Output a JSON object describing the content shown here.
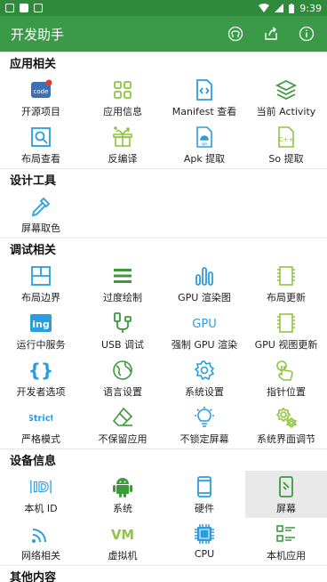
{
  "status_bar": {
    "time": "9:39"
  },
  "app_bar": {
    "title": "开发助手"
  },
  "colors": {
    "accent_green": "#3a9a48",
    "icon_blue": "#2a9de0",
    "icon_lime": "#8dc63f",
    "icon_dark_green": "#3c9a3c"
  },
  "sections": [
    {
      "title": "应用相关",
      "items": [
        {
          "label": "开源项目",
          "icon": "code-badge-icon"
        },
        {
          "label": "应用信息",
          "icon": "apps-grid-icon"
        },
        {
          "label": "Manifest 查看",
          "icon": "code-file-icon"
        },
        {
          "label": "当前 Activity",
          "icon": "layers-icon"
        },
        {
          "label": "布局查看",
          "icon": "layout-search-icon"
        },
        {
          "label": "反编译",
          "icon": "gift-box-icon"
        },
        {
          "label": "Apk 提取",
          "icon": "apk-file-icon"
        },
        {
          "label": "So 提取",
          "icon": "cpp-file-icon"
        }
      ]
    },
    {
      "title": "设计工具",
      "items": [
        {
          "label": "屏幕取色",
          "icon": "eyedropper-icon"
        }
      ]
    },
    {
      "title": "调试相关",
      "items": [
        {
          "label": "布局边界",
          "icon": "layout-bounds-icon"
        },
        {
          "label": "过度绘制",
          "icon": "overdraw-icon"
        },
        {
          "label": "GPU 渲染图",
          "icon": "bar-chart-icon"
        },
        {
          "label": "布局更新",
          "icon": "layout-update-icon"
        },
        {
          "label": "运行中服务",
          "icon": "ing-badge-icon"
        },
        {
          "label": "USB 调试",
          "icon": "usb-icon"
        },
        {
          "label": "强制 GPU 渲染",
          "icon": "gpu-text-icon"
        },
        {
          "label": "GPU 视图更新",
          "icon": "gpu-view-update-icon"
        },
        {
          "label": "开发者选项",
          "icon": "braces-icon"
        },
        {
          "label": "语言设置",
          "icon": "globe-icon"
        },
        {
          "label": "系统设置",
          "icon": "gear-icon"
        },
        {
          "label": "指针位置",
          "icon": "pointer-icon"
        },
        {
          "label": "严格模式",
          "icon": "strict-text-icon"
        },
        {
          "label": "不保留应用",
          "icon": "eraser-icon"
        },
        {
          "label": "不锁定屏幕",
          "icon": "bulb-icon"
        },
        {
          "label": "系统界面调节",
          "icon": "gears-icon"
        }
      ]
    },
    {
      "title": "设备信息",
      "items": [
        {
          "label": "本机 ID",
          "icon": "id-icon"
        },
        {
          "label": "系统",
          "icon": "android-icon"
        },
        {
          "label": "硬件",
          "icon": "phone-icon"
        },
        {
          "label": "屏幕",
          "icon": "screen-icon",
          "selected": true
        },
        {
          "label": "网络相关",
          "icon": "wifi-icon"
        },
        {
          "label": "虚拟机",
          "icon": "vm-text-icon"
        },
        {
          "label": "CPU",
          "icon": "cpu-icon"
        },
        {
          "label": "本机应用",
          "icon": "app-list-icon"
        }
      ]
    },
    {
      "title": "其他内容",
      "items": []
    }
  ]
}
